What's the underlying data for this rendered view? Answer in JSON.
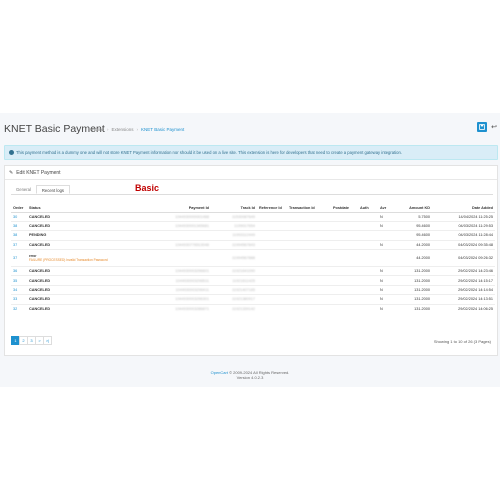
{
  "header": {
    "title": "KNET Basic Payment",
    "breadcrumb": [
      "Home",
      "Extensions",
      "KNET Basic Payment"
    ]
  },
  "alert": {
    "text": "This payment method is a dummy one and will not store KNET Payment information nor should it be used on a live site. This extension is here for developers that need to create a payment gateway integration."
  },
  "panel": {
    "heading": "Edit KNET Payment",
    "tabs": [
      "General",
      "Recent logs"
    ],
    "annotation": "Basic"
  },
  "table": {
    "columns": [
      "Order",
      "Status",
      "Payment Id",
      "Track Id",
      "Reference Id",
      "Transaction Id",
      "Postdate",
      "Auth",
      "Avr",
      "Amount KD",
      "Date Added"
    ],
    "rows": [
      {
        "order": "30",
        "status": "CANCELED",
        "payment_id": "1044930000001468",
        "track_id": "11530087649",
        "avr": "N",
        "amount": "5.7500",
        "date": "14/04/2024 11:25:25"
      },
      {
        "order": "38",
        "status": "CANCELED",
        "payment_id": "1044930001345681",
        "track_id": "1199017654",
        "avr": "N",
        "amount": "95.4600",
        "date": "04/03/2024 11:29:53"
      },
      {
        "order": "38",
        "status": "PENDING",
        "payment_id": "",
        "track_id": "11993112449",
        "avr": "",
        "amount": "95.4600",
        "date": "04/03/2024 11:28:44"
      },
      {
        "order": "37",
        "status": "CANCELED",
        "payment_id": "1044930776513048",
        "track_id": "11994567843",
        "avr": "N",
        "amount": "44.2000",
        "date": "04/03/2024 09:35:48"
      },
      {
        "order": "37",
        "status": "error",
        "error_detail": "FAILURE (PROCESSED) Invalid Transaction Password",
        "payment_id": "",
        "track_id": "11994567888",
        "avr": "",
        "amount": "44.2000",
        "date": "04/03/2024 09:26:32"
      },
      {
        "order": "36",
        "status": "CANCELED",
        "payment_id": "1044930003296601",
        "track_id": "11921641090",
        "avr": "N",
        "amount": "131.2000",
        "date": "29/02/2024 14:23:46"
      },
      {
        "order": "35",
        "status": "CANCELED",
        "payment_id": "1044930003296511",
        "track_id": "11921611425",
        "avr": "N",
        "amount": "131.2000",
        "date": "29/02/2024 14:15:17"
      },
      {
        "order": "34",
        "status": "CANCELED",
        "payment_id": "1044930003296411",
        "track_id": "11921407165",
        "avr": "N",
        "amount": "131.2000",
        "date": "29/02/2024 14:14:54"
      },
      {
        "order": "33",
        "status": "CANCELED",
        "payment_id": "1044930003296301",
        "track_id": "11921380917",
        "avr": "N",
        "amount": "131.2000",
        "date": "29/02/2024 14:13:51"
      },
      {
        "order": "32",
        "status": "CANCELED",
        "payment_id": "1044930003286871",
        "track_id": "11921339142",
        "avr": "N",
        "amount": "131.2000",
        "date": "29/02/2024 14:06:25"
      }
    ]
  },
  "pagination": {
    "pages": [
      "1",
      "2",
      "3",
      ">",
      ">|"
    ],
    "active": "1",
    "showing": "Showing 1 to 10 of 26 (3 Pages)"
  },
  "footer": {
    "brand": "OpenCart",
    "copyright": " © 2009-2024 All Rights Reserved.",
    "version": "Version 4.0.2.3"
  },
  "colors": {
    "accent": "#1e91cf",
    "alert_bg": "#d9edf7",
    "annotation": "#c00000",
    "error_text": "#e6892a"
  }
}
